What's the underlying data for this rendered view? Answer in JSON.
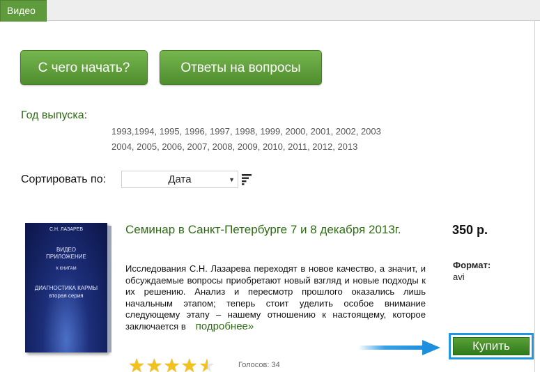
{
  "tabs": [
    {
      "label": "Видео",
      "active": true
    }
  ],
  "buttons": {
    "start": "С чего начать?",
    "faq": "Ответы на вопросы"
  },
  "year_filter": {
    "label": "Год выпуска",
    "colon": ":",
    "row1": [
      "1993",
      "1994",
      "1995",
      "1996",
      "1997",
      "1998",
      "1999",
      "2000",
      "2001",
      "2002",
      "2003"
    ],
    "row2": [
      "2004",
      "2005",
      "2006",
      "2007",
      "2008",
      "2009",
      "2010",
      "2011",
      "2012",
      "2013"
    ]
  },
  "sort": {
    "label": "Сортировать по:",
    "selected": "Дата"
  },
  "product": {
    "title": "Семинар в Санкт-Петербурге 7 и 8 декабря 2013г.",
    "description": "Исследования С.Н. Лазарева переходят в новое качество, а значит, и обсуждаемые вопросы приобретают новый взгляд и новые подходы к их решению. Анализ и пересмотр прошлого оказались лишь начальным этапом; теперь стоит уделить особое внимание следующему этапу – нашему отношению к настоящему, которое заключается в",
    "more_link": "подробнее»",
    "price": "350 р.",
    "format_label": "Формат:",
    "format_value": "avi",
    "rating": 4.5,
    "votes": "Голосов: 34",
    "buy_label": "Купить",
    "cover": {
      "author": "С.Н. ЛАЗАРЕВ",
      "title_line1": "ВИДЕО",
      "title_line2": "ПРИЛОЖЕНИЕ",
      "subtitle": "К КНИГАМ",
      "main_line1": "ДИАГНОСТИКА КАРМЫ",
      "main_line2": "вторая серия"
    }
  },
  "colors": {
    "accent_green": "#5f9a3c",
    "link_green": "#2e6b14",
    "highlight_blue": "#2196e3",
    "star": "#f2c21b"
  }
}
